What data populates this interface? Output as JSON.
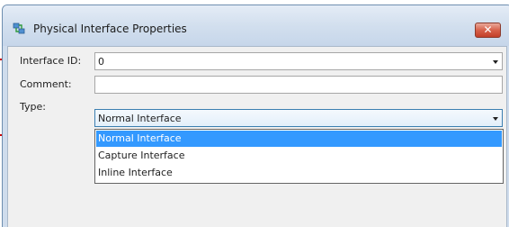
{
  "dialog": {
    "title": "Physical Interface Properties",
    "icon": "network-interface-icon",
    "close_icon": "close-icon",
    "close_glyph": "✕"
  },
  "form": {
    "interface_id": {
      "label": "Interface ID:",
      "value": "0"
    },
    "comment": {
      "label": "Comment:",
      "value": ""
    },
    "type": {
      "label": "Type:",
      "value": "Normal Interface",
      "options": [
        "Normal Interface",
        "Capture Interface",
        "Inline Interface"
      ],
      "selected_index": 0
    }
  },
  "colors": {
    "callout": "#cc0000",
    "selection": "#3399ff",
    "title_bar": "#d2dfee",
    "close_button": "#d7614a"
  }
}
